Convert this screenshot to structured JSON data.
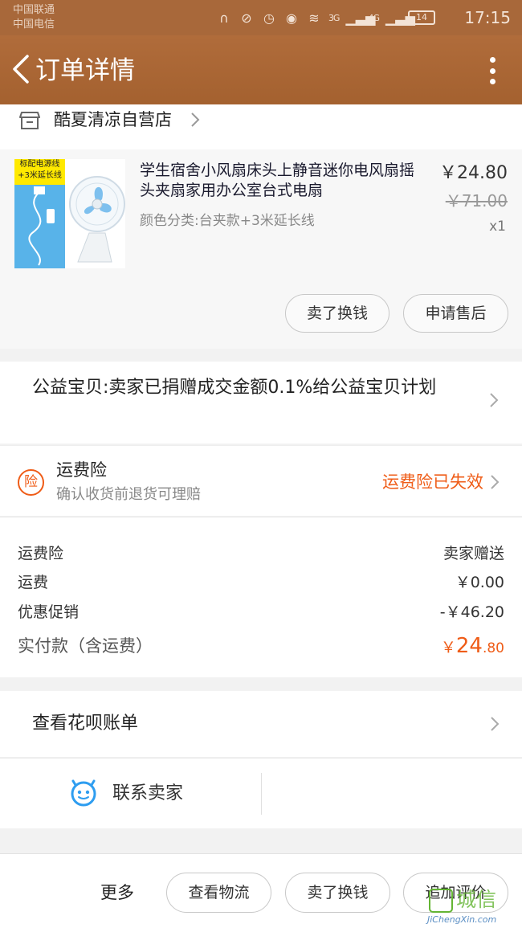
{
  "statusbar": {
    "carrier1": "中国联通",
    "carrier2": "中国电信",
    "network": "3G",
    "signal": "4G",
    "battery": "14",
    "time": "17:15"
  },
  "header": {
    "title": "订单详情"
  },
  "store": {
    "name": "酷夏清凉自营店"
  },
  "item": {
    "thumb_tag": "标配电源线 +3米延长线",
    "title": "学生宿舍小风扇床头上静音迷你电风扇摇头夹扇家用办公室台式电扇",
    "sku": "颜色分类:台夹款+3米延长线",
    "price": "￥24.80",
    "original_price": "￥71.00",
    "quantity": "x1",
    "sell_button": "卖了换钱",
    "after_sale_button": "申请售后"
  },
  "charity": {
    "text": "公益宝贝:卖家已捐赠成交金额0.1%给公益宝贝计划"
  },
  "insurance": {
    "badge": "险",
    "title": "运费险",
    "subtitle": "确认收货前退货可理赔",
    "status": "运费险已失效"
  },
  "fees": {
    "rows": [
      {
        "label": "运费险",
        "value": "卖家赠送"
      },
      {
        "label": "运费",
        "value": "￥0.00"
      },
      {
        "label": "优惠促销",
        "value": "-￥46.20"
      }
    ],
    "total_label": "实付款（含运费）",
    "total_currency": "￥",
    "total_int": "24",
    "total_dec": ".80"
  },
  "huabei": {
    "label": "查看花呗账单"
  },
  "contact": {
    "label": "联系卖家"
  },
  "bottom": {
    "more": "更多",
    "logistics": "查看物流",
    "sell": "卖了换钱",
    "review": "追加评价"
  },
  "watermark": {
    "text": "城信",
    "sub": "JiChengXin.com"
  },
  "colors": {
    "header": "#a8683a",
    "accent": "#ef5c17"
  }
}
